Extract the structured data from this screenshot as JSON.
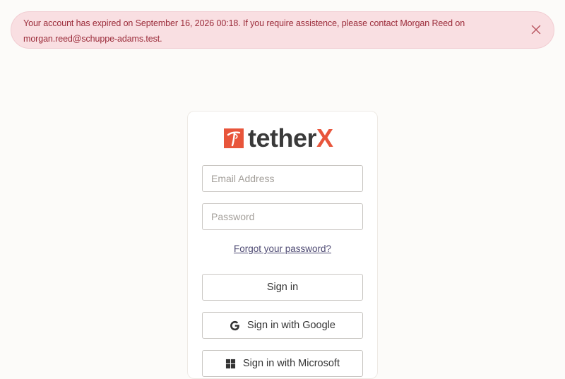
{
  "alert": {
    "message": "Your account has expired on September 16, 2026 00:18. If you require assistence, please contact Morgan Reed on morgan.reed@schuppe-adams.test.",
    "close_icon": "close-icon",
    "colors": {
      "background": "#f9dfe2",
      "text": "#9b2c3a"
    }
  },
  "logo": {
    "text_main": "tether",
    "text_accent": "X",
    "mark_icon": "tetherx-logo-mark",
    "accent_color": "#e8553b"
  },
  "form": {
    "email_placeholder": "Email Address",
    "email_value": "",
    "password_placeholder": "Password",
    "password_value": "",
    "forgot_label": "Forgot your password?",
    "signin_label": "Sign in",
    "google_label": "Sign in with Google",
    "google_icon": "google-icon",
    "microsoft_label": "Sign in with Microsoft",
    "microsoft_icon": "microsoft-icon"
  }
}
